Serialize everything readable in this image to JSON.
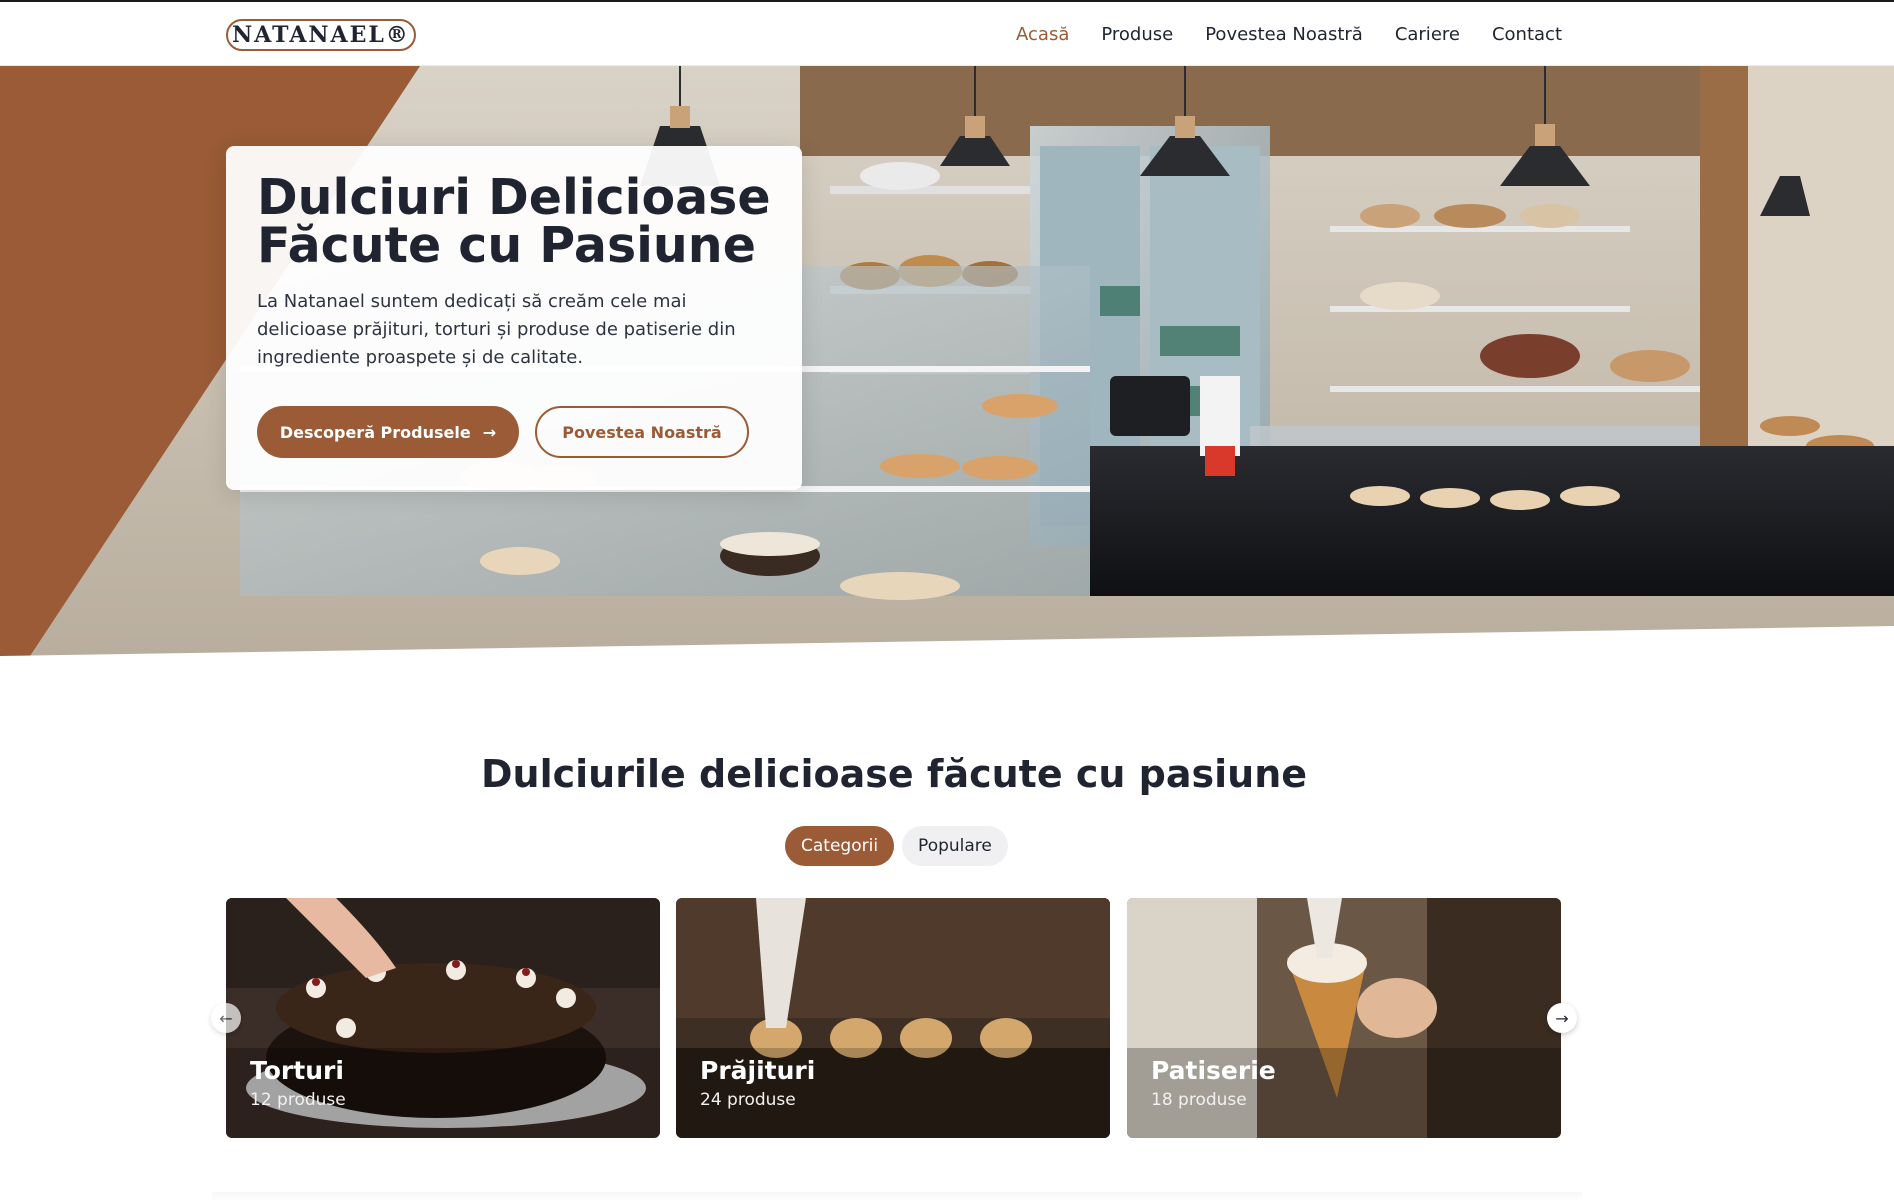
{
  "brand": {
    "logo_text": "NATANAEL®",
    "accent_color": "#9a5b36"
  },
  "nav": {
    "items": [
      {
        "label": "Acasă",
        "active": true
      },
      {
        "label": "Produse",
        "active": false
      },
      {
        "label": "Povestea Noastră",
        "active": false
      },
      {
        "label": "Cariere",
        "active": false
      },
      {
        "label": "Contact",
        "active": false
      }
    ]
  },
  "hero": {
    "title_line1": "Dulciuri Delicioase",
    "title_line2": "Făcute cu Pasiune",
    "description": "La Natanael suntem dedicați să creăm cele mai delicioase prăjituri, torturi și produse de patiserie din ingrediente proaspete și de calitate.",
    "primary_button": "Descoperă Produsele",
    "secondary_button": "Povestea Noastră"
  },
  "section": {
    "title": "Dulciurile delicioase făcute cu pasiune",
    "tabs": [
      {
        "label": "Categorii",
        "active": true
      },
      {
        "label": "Populare",
        "active": false
      }
    ],
    "cards": [
      {
        "title": "Torturi",
        "count": "12 produse"
      },
      {
        "title": "Prăjituri",
        "count": "24 produse"
      },
      {
        "title": "Patiserie",
        "count": "18 produse"
      }
    ]
  },
  "icons": {
    "arrow_right": "arrow-right-icon",
    "prev": "chevron-left-icon",
    "next": "chevron-right-icon"
  }
}
